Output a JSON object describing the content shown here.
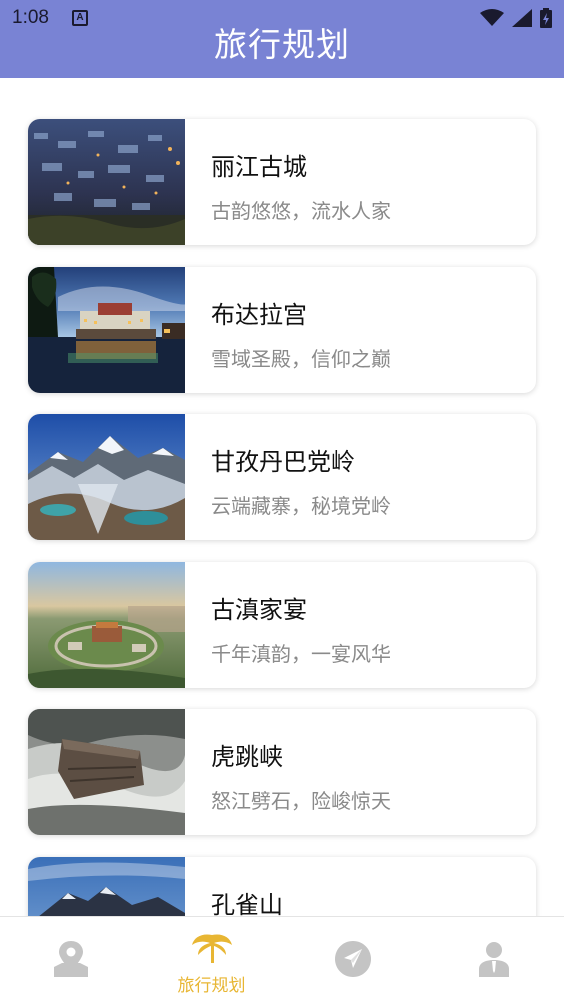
{
  "status": {
    "time": "1:08",
    "notif_letter": "A"
  },
  "header": {
    "title": "旅行规划"
  },
  "destinations": [
    {
      "title": "丽江古城",
      "subtitle": "古韵悠悠，流水人家"
    },
    {
      "title": "布达拉宫",
      "subtitle": "雪域圣殿，信仰之巅"
    },
    {
      "title": "甘孜丹巴党岭",
      "subtitle": "云端藏寨，秘境党岭"
    },
    {
      "title": "古滇家宴",
      "subtitle": "千年滇韵，一宴风华"
    },
    {
      "title": "虎跳峡",
      "subtitle": "怒江劈石，险峻惊天"
    },
    {
      "title": "孔雀山",
      "subtitle": ""
    }
  ],
  "tabbar": {
    "active_index": 1,
    "tabs": [
      {
        "icon": "map-pin-icon",
        "label": ""
      },
      {
        "icon": "palm-tree-icon",
        "label": "旅行规划"
      },
      {
        "icon": "plane-icon",
        "label": ""
      },
      {
        "icon": "user-icon",
        "label": ""
      }
    ]
  },
  "colors": {
    "header": "#7983d4",
    "accent": "#e8b633",
    "inactive_icon": "#c4c4c4"
  }
}
